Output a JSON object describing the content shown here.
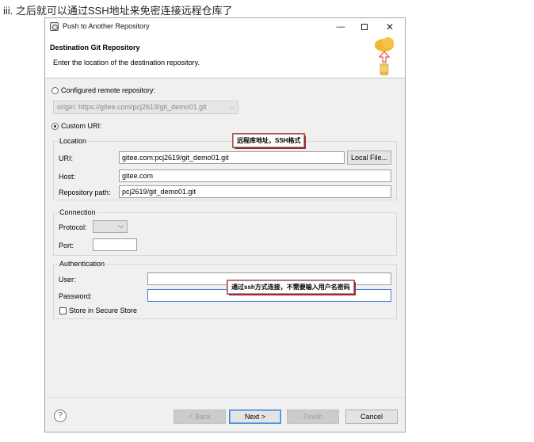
{
  "doc": {
    "heading": "iii. 之后就可以通过SSH地址来免密连接远程仓库了"
  },
  "window": {
    "title": "Push to Another Repository",
    "minimize": "—",
    "close": "✕"
  },
  "banner": {
    "title": "Destination Git Repository",
    "description": "Enter the location of the destination repository."
  },
  "source": {
    "configured_label": "Configured remote repository:",
    "configured_value": "origin: https://gitee.com/pcj2619/git_demo01.git",
    "custom_label": "Custom URI:"
  },
  "location": {
    "group_label": "Location",
    "uri_label": "URI:",
    "uri_value": "gitee.com:pcj2619/git_demo01.git",
    "local_file_button": "Local File...",
    "host_label": "Host:",
    "host_value": "gitee.com",
    "path_label": "Repository path:",
    "path_value": "pcj2619/git_demo01.git"
  },
  "connection": {
    "group_label": "Connection",
    "protocol_label": "Protocol:",
    "protocol_value": "",
    "port_label": "Port:",
    "port_value": ""
  },
  "authentication": {
    "group_label": "Authentication",
    "user_label": "User:",
    "user_value": "",
    "password_label": "Password:",
    "password_value": "",
    "store_label": "Store in Secure Store"
  },
  "annotations": {
    "uri_note": "远程库地址，SSH格式",
    "auth_note": "通过ssh方式连接，不需要输入用户名密码"
  },
  "footer": {
    "help": "?",
    "back": "< Back",
    "next": "Next >",
    "finish": "Finish",
    "cancel": "Cancel"
  },
  "colors": {
    "annotation_border": "#c0504d",
    "default_button_border": "#3c7fd9",
    "cloud": "#f5b731",
    "arrow": "#e05050"
  }
}
